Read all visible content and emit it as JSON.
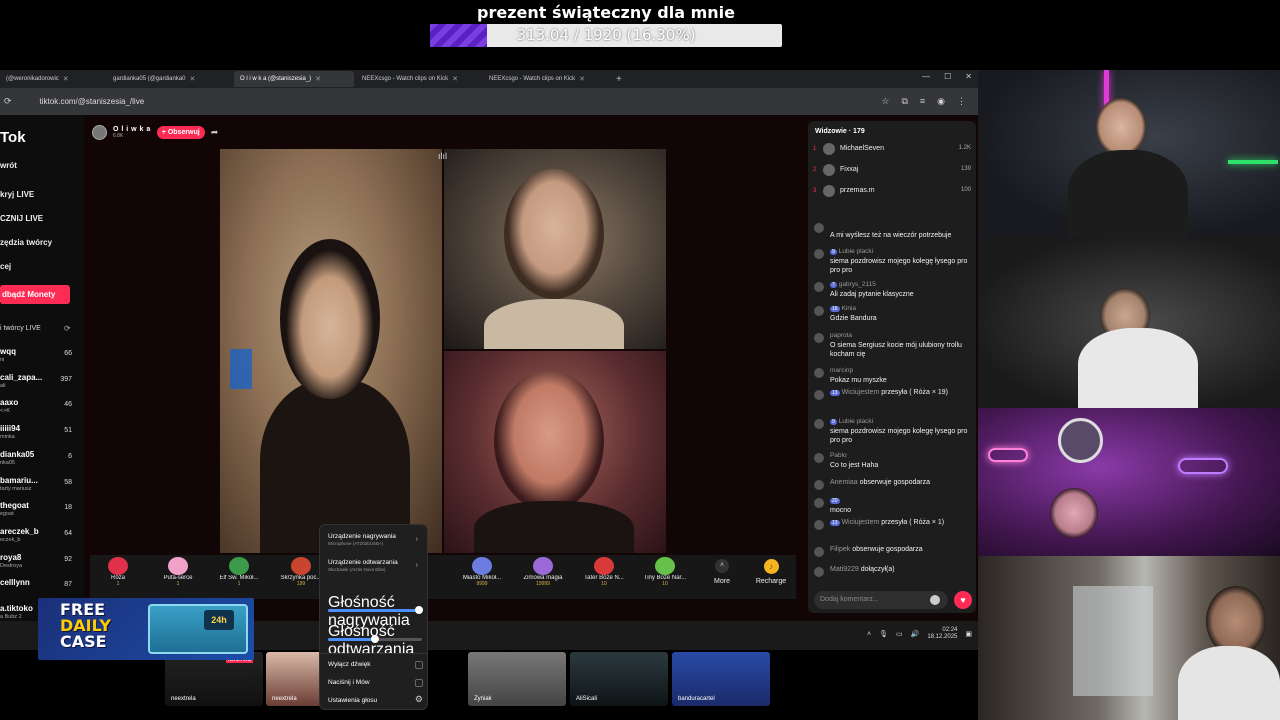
{
  "goal": {
    "title": "prezent świąteczny dla mnie",
    "progress_text": "313.04 / 1920 (16.30%)",
    "progress_fraction": 0.163
  },
  "browser": {
    "tabs": [
      {
        "label": "(@weronikadorowic",
        "active": false
      },
      {
        "label": "gardianka05 (@gardianka0",
        "active": false
      },
      {
        "label": "O l i w k a (@staniszesia_)",
        "active": true
      },
      {
        "label": "NEEXcsgo - Watch clips on Kick",
        "active": false
      },
      {
        "label": "NEEXcsgo - Watch clips on Kick",
        "active": false
      }
    ],
    "url": "tiktok.com/@staniszesia_/live"
  },
  "tiktok": {
    "brand": "Tok",
    "nav": [
      "wrót",
      "kryj LIVE",
      "CZNIJ LIVE",
      "zędzia twórcy",
      "cej"
    ],
    "coins_button": "dbądź Monety",
    "creators_section": "i twórcy LIVE",
    "creators": [
      {
        "name": "wqq",
        "sub": "ni",
        "count": "66"
      },
      {
        "name": "cali_zapa...",
        "sub": "ali",
        "count": "397"
      },
      {
        "name": "aaxo",
        "sub": "<>K",
        "count": "46"
      },
      {
        "name": "iiiii94",
        "sub": "minka",
        "count": "51"
      },
      {
        "name": "dianka05",
        "sub": "nka05",
        "count": "6"
      },
      {
        "name": "bamariu...",
        "sub": "tarty mariusz",
        "count": "58"
      },
      {
        "name": "thegoat",
        "sub": "egoat",
        "count": "18"
      },
      {
        "name": "areczek_b",
        "sub": "eczek_b",
        "count": "64"
      },
      {
        "name": "roya8",
        "sub": "Destroya",
        "count": "92"
      },
      {
        "name": "celllynn",
        "sub": "",
        "count": "87"
      },
      {
        "name": "a.tiktoko",
        "sub": "a Bubz 2",
        "count": ""
      }
    ],
    "streamer": {
      "name": "O l i w k a",
      "likes": "6.8K",
      "follow_label": "+ Obserwuj"
    },
    "gifts": [
      {
        "name": "Róża",
        "price": "1",
        "color": "#e0304a"
      },
      {
        "name": "Pufa-serce",
        "price": "1",
        "color": "#f2a1c8"
      },
      {
        "name": "Elf Św. Mikoł...",
        "price": "1",
        "color": "#3c9b4a"
      },
      {
        "name": "Skrzynka poc...",
        "price": "199",
        "color": "#c9452f"
      },
      {
        "name": "Miasto Mikoł...",
        "price": "9999",
        "color": "#6b7de0"
      },
      {
        "name": "Zimowa magia",
        "price": "19999",
        "color": "#9b6ad8"
      },
      {
        "name": "Tater Boże N...",
        "price": "10",
        "color": "#d83a3a"
      },
      {
        "name": "Tiny Boże Nar...",
        "price": "10",
        "color": "#67c04a"
      }
    ],
    "more_label": "More",
    "recharge_label": "Recharge"
  },
  "chat": {
    "viewers_title": "Widzowie · 179",
    "top_viewers": [
      {
        "rank": "1",
        "name": "MichaelSeven",
        "score": "1.2K"
      },
      {
        "rank": "2",
        "name": "Fixxaj",
        "score": "139"
      },
      {
        "rank": "3",
        "name": "przemas.m",
        "score": "100"
      }
    ],
    "messages": [
      {
        "user": "",
        "badge": "",
        "text": "A mi wyślesz też na wieczór potrzebuje",
        "inline": false
      },
      {
        "user": "Lubie placki",
        "badge": "9",
        "text": "siema pozdrowisz mojego kolegę łysego pro pro pro",
        "inline": false
      },
      {
        "user": "gabrys_2115",
        "badge": "7",
        "text": "Ali zadaj pytanie klasyczne",
        "inline": false
      },
      {
        "user": "Kinia",
        "badge": "16",
        "text": "Gdzie Bandura",
        "inline": false
      },
      {
        "user": "paprota",
        "badge": "",
        "text": "O siema Sergiusz kocie mój ulubiony trollu kocham cię",
        "inline": false
      },
      {
        "user": "marcinp",
        "badge": "",
        "text": "Pokaz mu myszke",
        "inline": false
      },
      {
        "user": "Wiciujestem",
        "badge": "13",
        "text": "przesyła ( Róża × 19)",
        "inline": true
      },
      {
        "user": "Lubie placki",
        "badge": "9",
        "text": "siema pozdrowisz mojego kolegę łysego pro pro pro",
        "inline": false
      },
      {
        "user": "Pablo",
        "badge": "",
        "text": "Co to jest Haha",
        "inline": false
      },
      {
        "user": "Anemiaa",
        "badge": "",
        "text": "obserwuje gospodarza",
        "inline": true
      },
      {
        "user": "",
        "badge": "20",
        "text": "mocno",
        "inline": false
      },
      {
        "user": "Wiciujestem",
        "badge": "13",
        "text": "przesyła ( Róża × 1)",
        "inline": true
      },
      {
        "user": "Filipek",
        "badge": "",
        "text": "obserwuje gospodarza",
        "inline": true
      },
      {
        "user": "Mati9229",
        "badge": "",
        "text": "dołączył(a)",
        "inline": true
      }
    ],
    "input_placeholder": "Dodaj komentarz..."
  },
  "taskbar": {
    "time": "02:24",
    "date": "18.12.2025"
  },
  "audio_popup": {
    "recording_device": "Urządzenie nagrywania",
    "recording_device_sub": "Microphone (AT2020USB+)",
    "playback_device": "Urządzenie odtwarzania",
    "playback_device_sub": "Słuchawki (Arctis Nova Elite)",
    "recording_volume": "Głośność nagrywania",
    "recording_volume_level": 0.97,
    "playback_volume": "Głośność odtwarzania",
    "playback_volume_level": 0.5,
    "mute": "Wyłącz dźwięk",
    "push_to_talk": "Naciśnij i Mów",
    "settings": "Ustawienia głosu"
  },
  "thumbnails": [
    {
      "label": "neextrela"
    },
    {
      "label": "neextrela"
    },
    {
      "label": "Zyniak"
    },
    {
      "label": "AliSicali"
    },
    {
      "label": "banduracartel"
    }
  ],
  "live_badge": "NA ŻYWO",
  "ad": {
    "line1": "FREE",
    "line2": "DAILY",
    "line3": "CASE",
    "badge": "24h"
  }
}
